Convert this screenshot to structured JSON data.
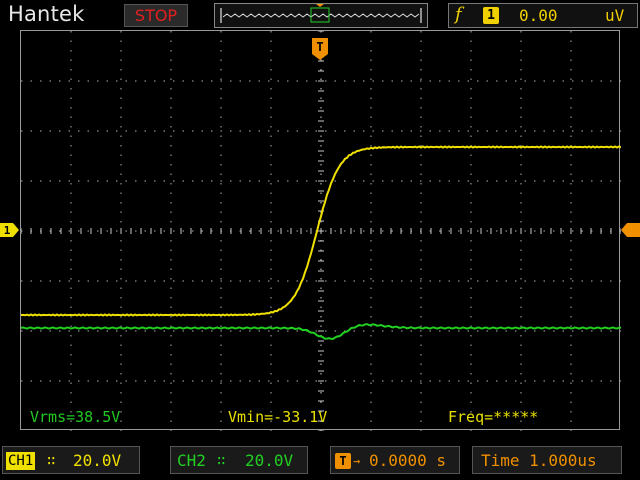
{
  "header": {
    "brand": "Hantek",
    "run_state": "STOP",
    "trigger_source_symbol": "f",
    "trigger_channel": "1",
    "trigger_level": "0.00",
    "trigger_unit": "uV"
  },
  "markers": {
    "trigger_top": "T",
    "ch1_ground": "1"
  },
  "measurements": {
    "vrms": "Vrms=38.5V",
    "vmin": "Vmin=-33.1V",
    "freq": "Freq=*****"
  },
  "footer": {
    "ch1_label": "CH1",
    "ch1_scale": "20.0V",
    "ch2_label": "CH2",
    "ch2_scale": "20.0V",
    "trigger_pos": "0.0000 s",
    "timebase": "Time 1.000us"
  },
  "colors": {
    "ch1": "#f0e000",
    "ch2": "#22d022",
    "trigger": "#f09000",
    "stop": "#e02020"
  }
}
